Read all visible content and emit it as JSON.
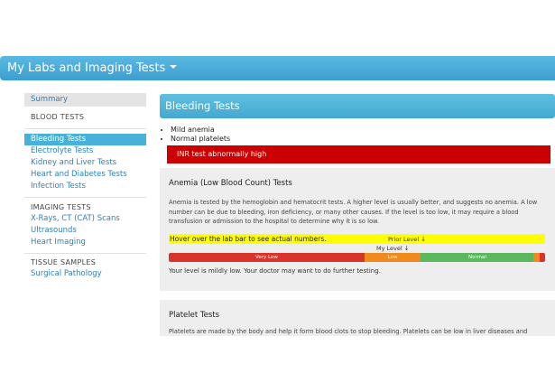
{
  "app": {
    "title": "My Labs and Imaging Tests"
  },
  "sidebar": {
    "summary": "Summary",
    "blood_tests_heading": "BLOOD TESTS",
    "blood_tests": [
      "Bleeding Tests",
      "Electrolyte Tests",
      "Kidney and Liver Tests",
      "Heart and Diabetes Tests",
      "Infection Tests"
    ],
    "imaging_heading": "IMAGING TESTS",
    "imaging_tests": [
      "X-Rays, CT (CAT) Scans",
      "Ultrasounds",
      "Heart Imaging"
    ],
    "tissue_heading": "TISSUE SAMPLES",
    "tissue_tests": [
      "Surgical Pathology"
    ],
    "active_item": "Bleeding Tests"
  },
  "section": {
    "title": "Bleeding Tests",
    "summary_items": [
      "Mild anemia",
      "Normal platelets"
    ],
    "alert": "INR test abnormally high",
    "alert_color": "#cc0000"
  },
  "anemia_card": {
    "title": "Anemia (Low Blood Count) Tests",
    "description": "Anemia is tested by the hemoglobin and hematocrit tests. A higher level is usually better, and suggests no anemia. A low number can be due to bleeding, iron deficiency, or many other causes. If the level is too low, it may require a blood transfusion or admission to the hospital to determine why it is so low.",
    "hint": "Hover over the lab bar to see actual numbers.",
    "prior_level_label": "Prior Level",
    "my_level_label": "My Level",
    "bar_segments": [
      {
        "label": "Very Low",
        "color": "#d9342b",
        "share": 0.52
      },
      {
        "label": "Low",
        "color": "#f08a1c",
        "share": 0.15
      },
      {
        "label": "Normal",
        "color": "#5cb85c",
        "share": 0.3
      },
      {
        "label": "",
        "color": "#f08a1c",
        "share": 0.015
      },
      {
        "label": "",
        "color": "#d9342b",
        "share": 0.015
      }
    ],
    "result": "Your level is mildly low. Your doctor may want to do further testing."
  },
  "platelet_card": {
    "title": "Platelet Tests",
    "description": "Platelets are made by the body and help it form blood clots to stop bleeding. Platelets can be low in liver diseases and"
  }
}
